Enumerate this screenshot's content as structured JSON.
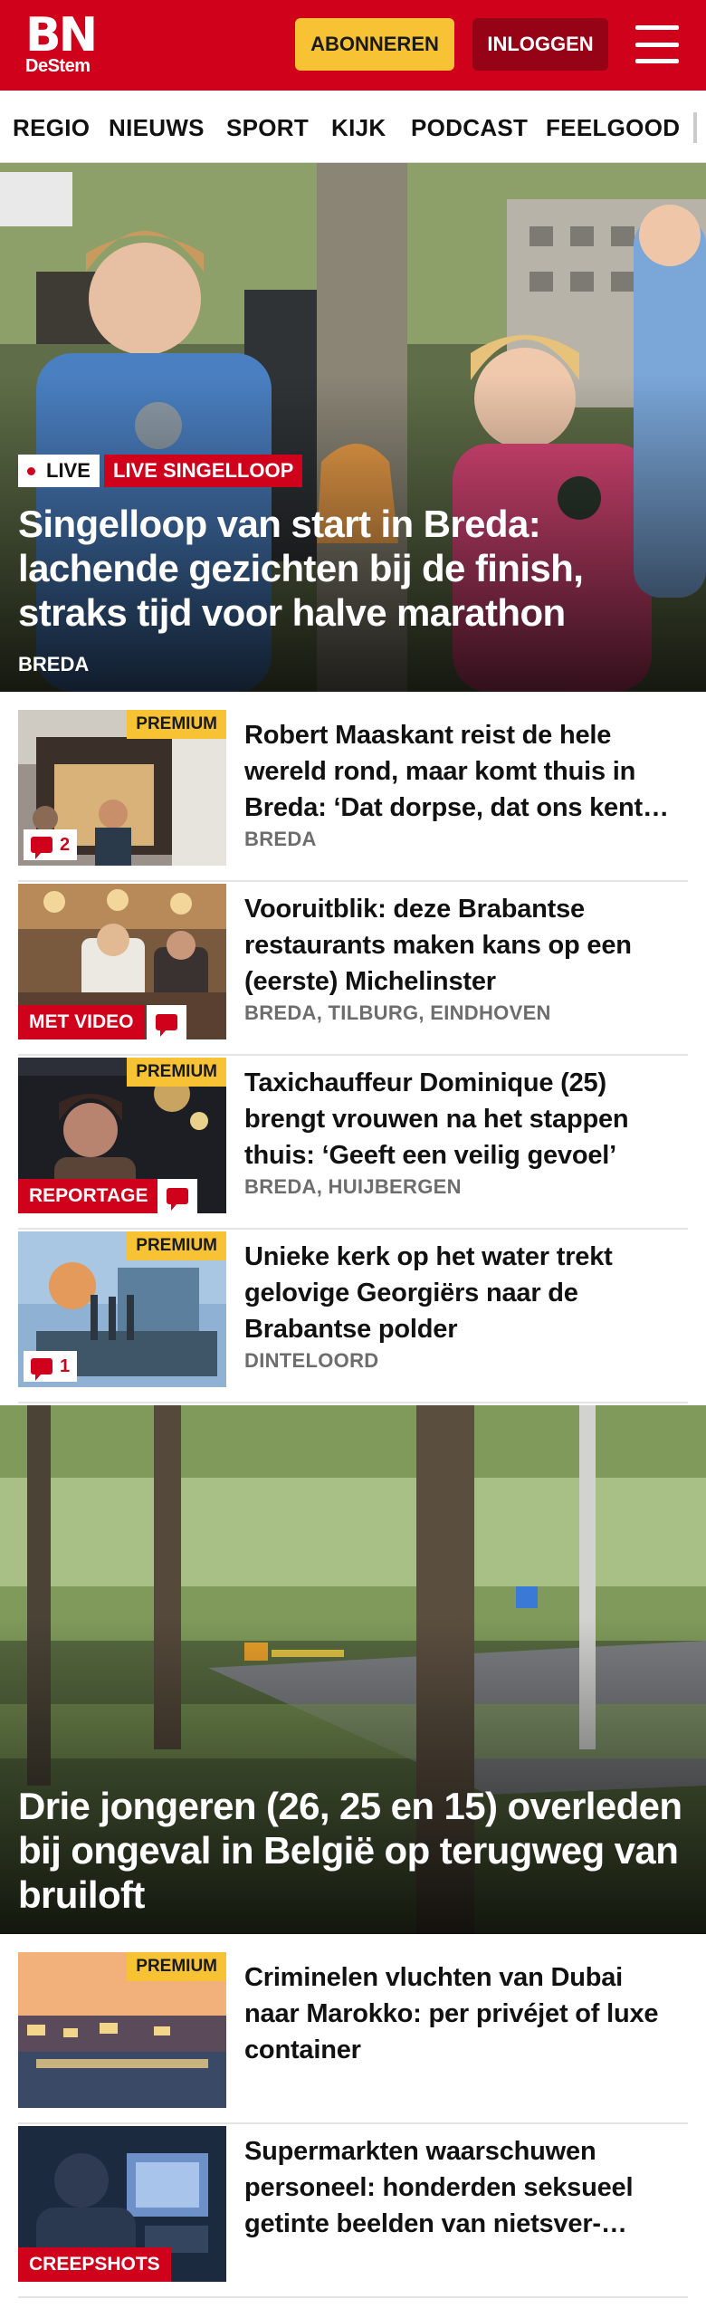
{
  "header": {
    "logo_main": "BN",
    "logo_sub": "DeStem",
    "subscribe_label": "ABONNEREN",
    "login_label": "INLOGGEN",
    "brand_color": "#d0021b",
    "accent_color": "#f7c233"
  },
  "nav": {
    "items": [
      "REGIO",
      "NIEUWS",
      "SPORT",
      "KIJK",
      "PODCAST",
      "FEELGOOD"
    ]
  },
  "hero1": {
    "live_label": "LIVE",
    "topic_label": "LIVE SINGELLOOP",
    "title": "Singelloop van start in Breda: lachende gezichten bij de finish, straks tijd voor halve marathon",
    "location": "BREDA"
  },
  "articles": [
    {
      "title": "Robert Maaskant reist de hele wereld rond, maar komt thuis in Breda: ‘Dat dorpse, dat ons kent…",
      "location": "BREDA",
      "premium": "PREMIUM",
      "comments": "2"
    },
    {
      "title": "Vooruitblik: deze Brabantse restaurants maken kans op een (eerste) Michelinster",
      "location": "BREDA, TILBURG, EINDHOVEN",
      "tag": "MET VIDEO"
    },
    {
      "title": "Taxichauffeur Dominique (25) brengt vrouwen na het stappen thuis: ‘Geeft een veilig gevoel’",
      "location": "BREDA, HUIJBERGEN",
      "premium": "PREMIUM",
      "tag": "REPORTAGE"
    },
    {
      "title": "Unieke kerk op het water trekt gelovige Georgiërs naar de Brabantse polder",
      "location": "DINTELOORD",
      "premium": "PREMIUM",
      "comments": "1"
    }
  ],
  "hero2": {
    "title": "Drie jongeren (26, 25 en 15) overleden bij ongeval in België op terugweg van bruiloft"
  },
  "articles2": [
    {
      "title": "Criminelen vluchten van Dubai naar Marokko: per privéjet of luxe container",
      "premium": "PREMIUM"
    },
    {
      "title": "Supermarkten waarschuwen personeel: honderden seksueel getinte beelden van nietsver-…",
      "tag": "CREEPSHOTS"
    }
  ]
}
